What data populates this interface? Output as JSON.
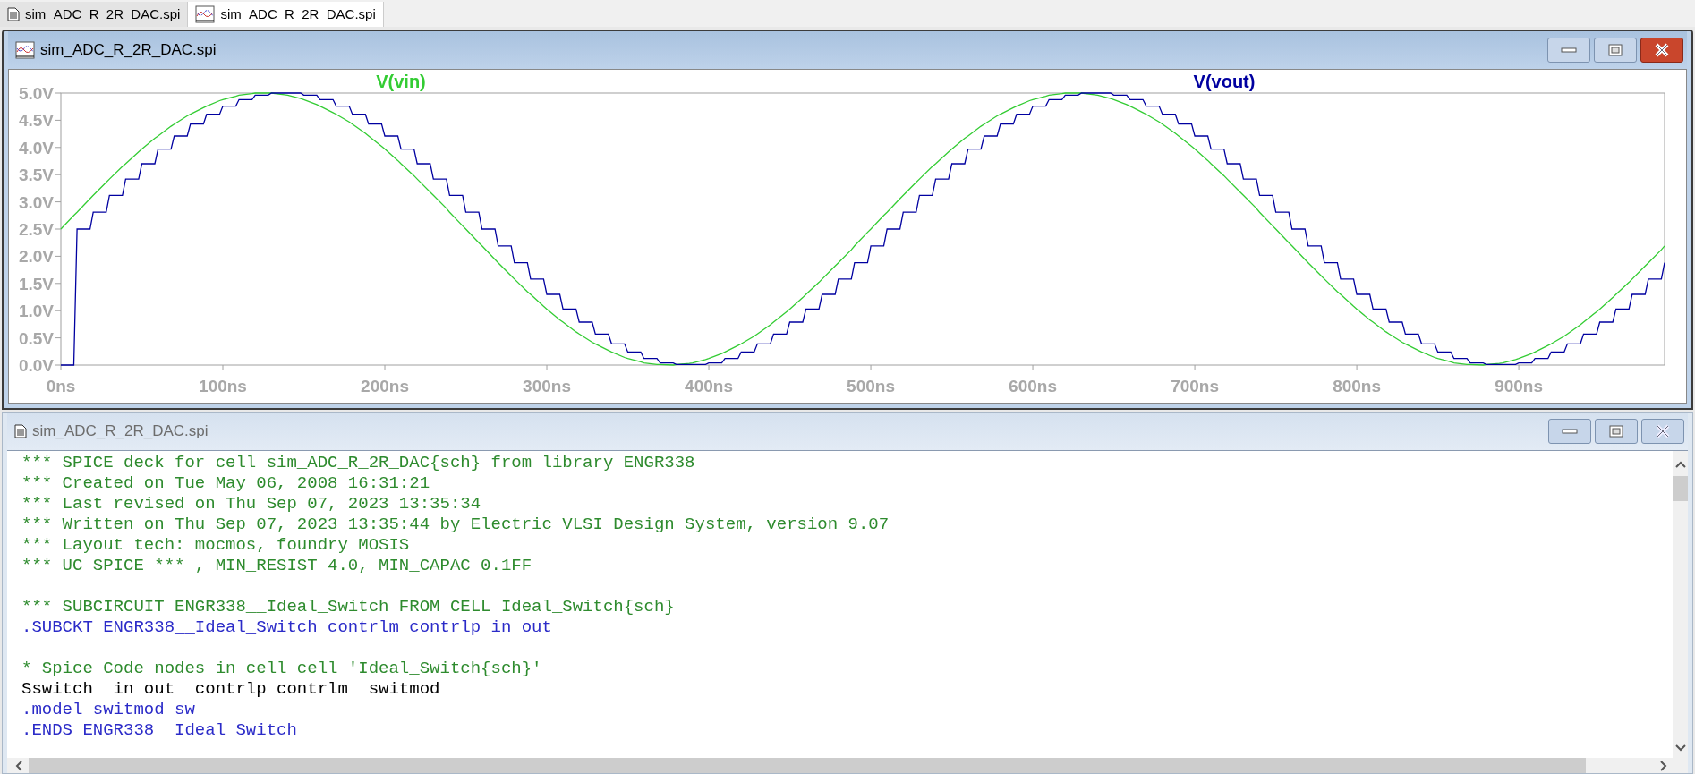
{
  "tabs": [
    {
      "label": "sim_ADC_R_2R_DAC.spi",
      "kind": "text",
      "selected": false
    },
    {
      "label": "sim_ADC_R_2R_DAC.spi",
      "kind": "waveform",
      "selected": true
    }
  ],
  "plot_window": {
    "title": "sim_ADC_R_2R_DAC.spi",
    "active": true,
    "chart_data": {
      "type": "line",
      "x": [
        0,
        8,
        10,
        18,
        20,
        28,
        30,
        38,
        40,
        48,
        50,
        58,
        60,
        68,
        70,
        78,
        80,
        88,
        90,
        98,
        100,
        108,
        110,
        118,
        120,
        128,
        130,
        138,
        140,
        148,
        150,
        158,
        160,
        168,
        170,
        178,
        180,
        188,
        190,
        198,
        200,
        208,
        210,
        218,
        220,
        228,
        230,
        238,
        240,
        248,
        250,
        258,
        260,
        268,
        270,
        278,
        280,
        288,
        290,
        298,
        300,
        308,
        310,
        318,
        320,
        328,
        330,
        338,
        340,
        348,
        350,
        358,
        360,
        368,
        370,
        378,
        380,
        388,
        390,
        398,
        400,
        408,
        410,
        418,
        420,
        428,
        430,
        438,
        440,
        448,
        450,
        458,
        460,
        468,
        470,
        478,
        480,
        488,
        490,
        498,
        500,
        508,
        510,
        518,
        520,
        528,
        530,
        538,
        540,
        548,
        550,
        558,
        560,
        568,
        570,
        578,
        580,
        588,
        590,
        598,
        600,
        608,
        610,
        618,
        620,
        628,
        630,
        638,
        640,
        648,
        650,
        658,
        660,
        668,
        670,
        678,
        680,
        688,
        690,
        698,
        700,
        708,
        710,
        718,
        720,
        728,
        730,
        738,
        740,
        748,
        750,
        758,
        760,
        768,
        770,
        778,
        780,
        788,
        790,
        798,
        800,
        808,
        810,
        818,
        820,
        828,
        830,
        838,
        840,
        848,
        850,
        858,
        860,
        868,
        870,
        878,
        880,
        888,
        890,
        898,
        900,
        908,
        910,
        918,
        920,
        928,
        930,
        938,
        940,
        948,
        950,
        958,
        960,
        968,
        970,
        978,
        980,
        988,
        990
      ],
      "series": [
        {
          "name": "V(vin)",
          "color": "#33cc33",
          "values": [
            2.5,
            2.75,
            2.81,
            3.06,
            3.12,
            3.36,
            3.42,
            3.65,
            3.7,
            3.92,
            3.97,
            4.17,
            4.21,
            4.39,
            4.43,
            4.58,
            4.61,
            4.73,
            4.76,
            4.86,
            4.88,
            4.94,
            4.96,
            4.99,
            5.0,
            5.0,
            5.0,
            4.97,
            4.96,
            4.9,
            4.88,
            4.79,
            4.76,
            4.64,
            4.61,
            4.47,
            4.43,
            4.26,
            4.21,
            4.02,
            3.97,
            3.76,
            3.7,
            3.48,
            3.42,
            3.18,
            3.12,
            2.88,
            2.81,
            2.56,
            2.5,
            2.25,
            2.19,
            1.94,
            1.88,
            1.64,
            1.58,
            1.35,
            1.3,
            1.08,
            1.03,
            0.83,
            0.79,
            0.61,
            0.57,
            0.42,
            0.39,
            0.27,
            0.24,
            0.14,
            0.12,
            0.06,
            0.04,
            0.01,
            0.01,
            0.0,
            0.01,
            0.03,
            0.04,
            0.1,
            0.12,
            0.21,
            0.24,
            0.36,
            0.39,
            0.53,
            0.57,
            0.74,
            0.79,
            0.98,
            1.03,
            1.24,
            1.3,
            1.52,
            1.58,
            1.82,
            1.88,
            2.12,
            2.19,
            2.44,
            2.5,
            2.75,
            2.81,
            3.06,
            3.12,
            3.36,
            3.42,
            3.65,
            3.7,
            3.92,
            3.97,
            4.17,
            4.21,
            4.39,
            4.43,
            4.58,
            4.61,
            4.73,
            4.76,
            4.86,
            4.88,
            4.94,
            4.96,
            4.99,
            5.0,
            5.0,
            5.0,
            4.97,
            4.96,
            4.9,
            4.88,
            4.79,
            4.76,
            4.64,
            4.61,
            4.47,
            4.43,
            4.26,
            4.21,
            4.02,
            3.97,
            3.76,
            3.7,
            3.48,
            3.42,
            3.18,
            3.12,
            2.88,
            2.81,
            2.56,
            2.5,
            2.25,
            2.19,
            1.94,
            1.88,
            1.64,
            1.58,
            1.35,
            1.3,
            1.08,
            1.03,
            0.83,
            0.79,
            0.61,
            0.57,
            0.42,
            0.39,
            0.27,
            0.24,
            0.14,
            0.12,
            0.06,
            0.04,
            0.01,
            0.01,
            0.0,
            0.01,
            0.03,
            0.04,
            0.1,
            0.12,
            0.21,
            0.24,
            0.36,
            0.39,
            0.53,
            0.57,
            0.74,
            0.79,
            0.98,
            1.03,
            1.24,
            1.3,
            1.52,
            1.58,
            1.82,
            1.88,
            2.12,
            2.19
          ]
        },
        {
          "name": "V(vout)",
          "color": "#0000a0",
          "values": [
            0,
            0,
            2.5,
            2.5,
            2.81,
            2.81,
            3.12,
            3.12,
            3.42,
            3.42,
            3.7,
            3.7,
            3.97,
            3.97,
            4.21,
            4.21,
            4.43,
            4.43,
            4.61,
            4.61,
            4.76,
            4.76,
            4.88,
            4.88,
            4.96,
            4.96,
            5.0,
            5.0,
            5.0,
            5.0,
            4.96,
            4.96,
            4.88,
            4.88,
            4.76,
            4.76,
            4.61,
            4.61,
            4.43,
            4.43,
            4.21,
            4.21,
            3.97,
            3.97,
            3.7,
            3.7,
            3.42,
            3.42,
            3.12,
            3.12,
            2.81,
            2.81,
            2.5,
            2.5,
            2.19,
            2.19,
            1.88,
            1.88,
            1.58,
            1.58,
            1.3,
            1.3,
            1.03,
            1.03,
            0.79,
            0.79,
            0.57,
            0.57,
            0.39,
            0.39,
            0.24,
            0.24,
            0.12,
            0.12,
            0.04,
            0.04,
            0.01,
            0.01,
            0.01,
            0.01,
            0.04,
            0.04,
            0.12,
            0.12,
            0.24,
            0.24,
            0.39,
            0.39,
            0.57,
            0.57,
            0.79,
            0.79,
            1.03,
            1.03,
            1.3,
            1.3,
            1.58,
            1.58,
            1.88,
            1.88,
            2.19,
            2.19,
            2.5,
            2.5,
            2.81,
            2.81,
            3.12,
            3.12,
            3.42,
            3.42,
            3.7,
            3.7,
            3.97,
            3.97,
            4.21,
            4.21,
            4.43,
            4.43,
            4.61,
            4.61,
            4.76,
            4.76,
            4.88,
            4.88,
            4.96,
            4.96,
            5.0,
            5.0,
            5.0,
            5.0,
            4.96,
            4.96,
            4.88,
            4.88,
            4.76,
            4.76,
            4.61,
            4.61,
            4.43,
            4.43,
            4.21,
            4.21,
            3.97,
            3.97,
            3.7,
            3.7,
            3.42,
            3.42,
            3.12,
            3.12,
            2.81,
            2.81,
            2.5,
            2.5,
            2.19,
            2.19,
            1.88,
            1.88,
            1.58,
            1.58,
            1.3,
            1.3,
            1.03,
            1.03,
            0.79,
            0.79,
            0.57,
            0.57,
            0.39,
            0.39,
            0.24,
            0.24,
            0.12,
            0.12,
            0.04,
            0.04,
            0.01,
            0.01,
            0.01,
            0.01,
            0.04,
            0.04,
            0.12,
            0.12,
            0.24,
            0.24,
            0.39,
            0.39,
            0.57,
            0.57,
            0.79,
            0.79,
            1.03,
            1.03,
            1.3,
            1.3,
            1.58,
            1.58,
            1.88
          ]
        }
      ],
      "xlim": [
        0,
        990
      ],
      "ylim": [
        0,
        5
      ],
      "xticks": [
        {
          "value": 0,
          "label": "0ns"
        },
        {
          "value": 100,
          "label": "100ns"
        },
        {
          "value": 200,
          "label": "200ns"
        },
        {
          "value": 300,
          "label": "300ns"
        },
        {
          "value": 400,
          "label": "400ns"
        },
        {
          "value": 500,
          "label": "500ns"
        },
        {
          "value": 600,
          "label": "600ns"
        },
        {
          "value": 700,
          "label": "700ns"
        },
        {
          "value": 800,
          "label": "800ns"
        },
        {
          "value": 900,
          "label": "900ns"
        }
      ],
      "yticks": [
        {
          "value": 0,
          "label": "0.0V"
        },
        {
          "value": 0.5,
          "label": "0.5V"
        },
        {
          "value": 1,
          "label": "1.0V"
        },
        {
          "value": 1.5,
          "label": "1.5V"
        },
        {
          "value": 2,
          "label": "2.0V"
        },
        {
          "value": 2.5,
          "label": "2.5V"
        },
        {
          "value": 3,
          "label": "3.0V"
        },
        {
          "value": 3.5,
          "label": "3.5V"
        },
        {
          "value": 4,
          "label": "4.0V"
        },
        {
          "value": 4.5,
          "label": "4.5V"
        },
        {
          "value": 5,
          "label": "5.0V"
        }
      ]
    }
  },
  "text_window": {
    "title": "sim_ADC_R_2R_DAC.spi",
    "active": false,
    "lines": [
      {
        "kind": "comment",
        "text": "*** SPICE deck for cell sim_ADC_R_2R_DAC{sch} from library ENGR338"
      },
      {
        "kind": "comment",
        "text": "*** Created on Tue May 06, 2008 16:31:21"
      },
      {
        "kind": "comment",
        "text": "*** Last revised on Thu Sep 07, 2023 13:35:34"
      },
      {
        "kind": "comment",
        "text": "*** Written on Thu Sep 07, 2023 13:35:44 by Electric VLSI Design System, version 9.07"
      },
      {
        "kind": "comment",
        "text": "*** Layout tech: mocmos, foundry MOSIS"
      },
      {
        "kind": "comment",
        "text": "*** UC SPICE *** , MIN_RESIST 4.0, MIN_CAPAC 0.1FF"
      },
      {
        "kind": "blank"
      },
      {
        "kind": "comment",
        "text": "*** SUBCIRCUIT ENGR338__Ideal_Switch FROM CELL Ideal_Switch{sch}"
      },
      {
        "kind": "directive",
        "text": ".SUBCKT ENGR338__Ideal_Switch contrlm contrlp in out"
      },
      {
        "kind": "blank"
      },
      {
        "kind": "comment",
        "text": "* Spice Code nodes in cell cell 'Ideal_Switch{sch}'"
      },
      {
        "kind": "plain",
        "text": "Sswitch  in out  contrlp contrlm  switmod"
      },
      {
        "kind": "directive",
        "text": ".model switmod sw"
      },
      {
        "kind": "directive",
        "text": ".ENDS ENGR338__Ideal_Switch"
      }
    ]
  }
}
